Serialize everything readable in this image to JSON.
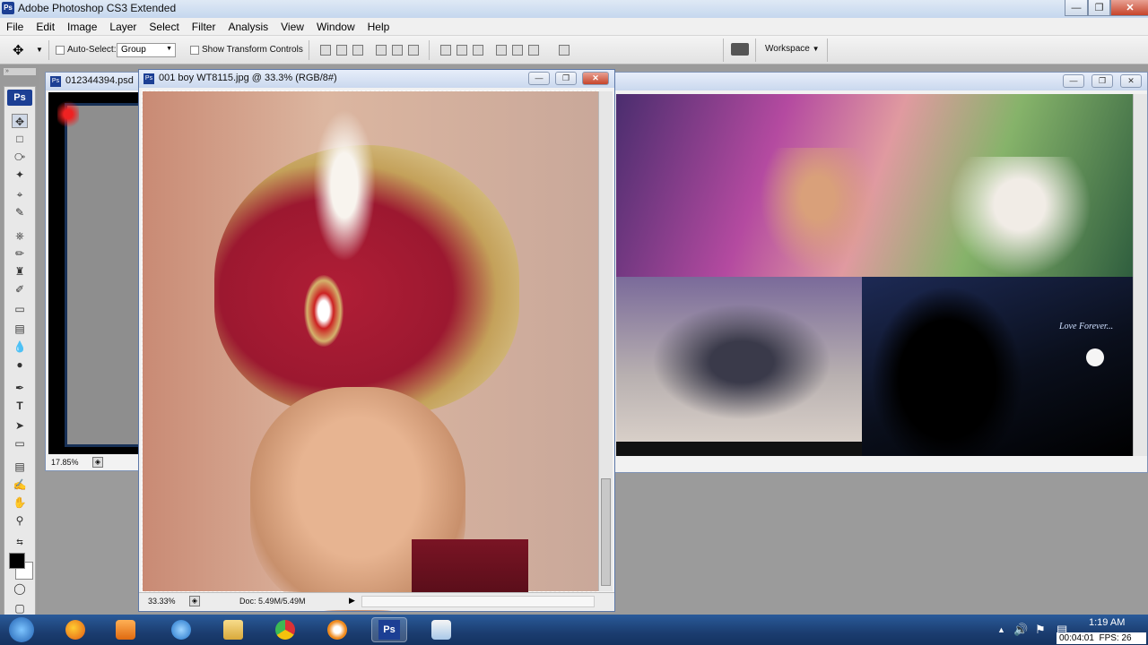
{
  "app": {
    "title": "Adobe Photoshop CS3 Extended",
    "icon": "Ps"
  },
  "menu": [
    "File",
    "Edit",
    "Image",
    "Layer",
    "Select",
    "Filter",
    "Analysis",
    "View",
    "Window",
    "Help"
  ],
  "options": {
    "auto_select_label": "Auto-Select:",
    "auto_select_value": "Group",
    "transform_label": "Show Transform Controls",
    "workspace_label": "Workspace"
  },
  "docs": {
    "back": {
      "title": "012344394.psd",
      "zoom": "17.85%"
    },
    "front": {
      "title": "001 boy WT8115.jpg @ 33.3% (RGB/8#)",
      "zoom": "33.33%",
      "doc_info": "Doc: 5.49M/5.49M"
    },
    "album": {
      "caption": "Love Forever..."
    }
  },
  "toolbox": {
    "badge": "Ps",
    "type_tool": "T"
  },
  "taskbar": {
    "time": "1:19 AM",
    "recorder": "00:04:01  FPS: 26",
    "ps_label": "Ps"
  },
  "colors": {
    "accent": "#1c3f94",
    "taskbar": "#1b3d70"
  }
}
